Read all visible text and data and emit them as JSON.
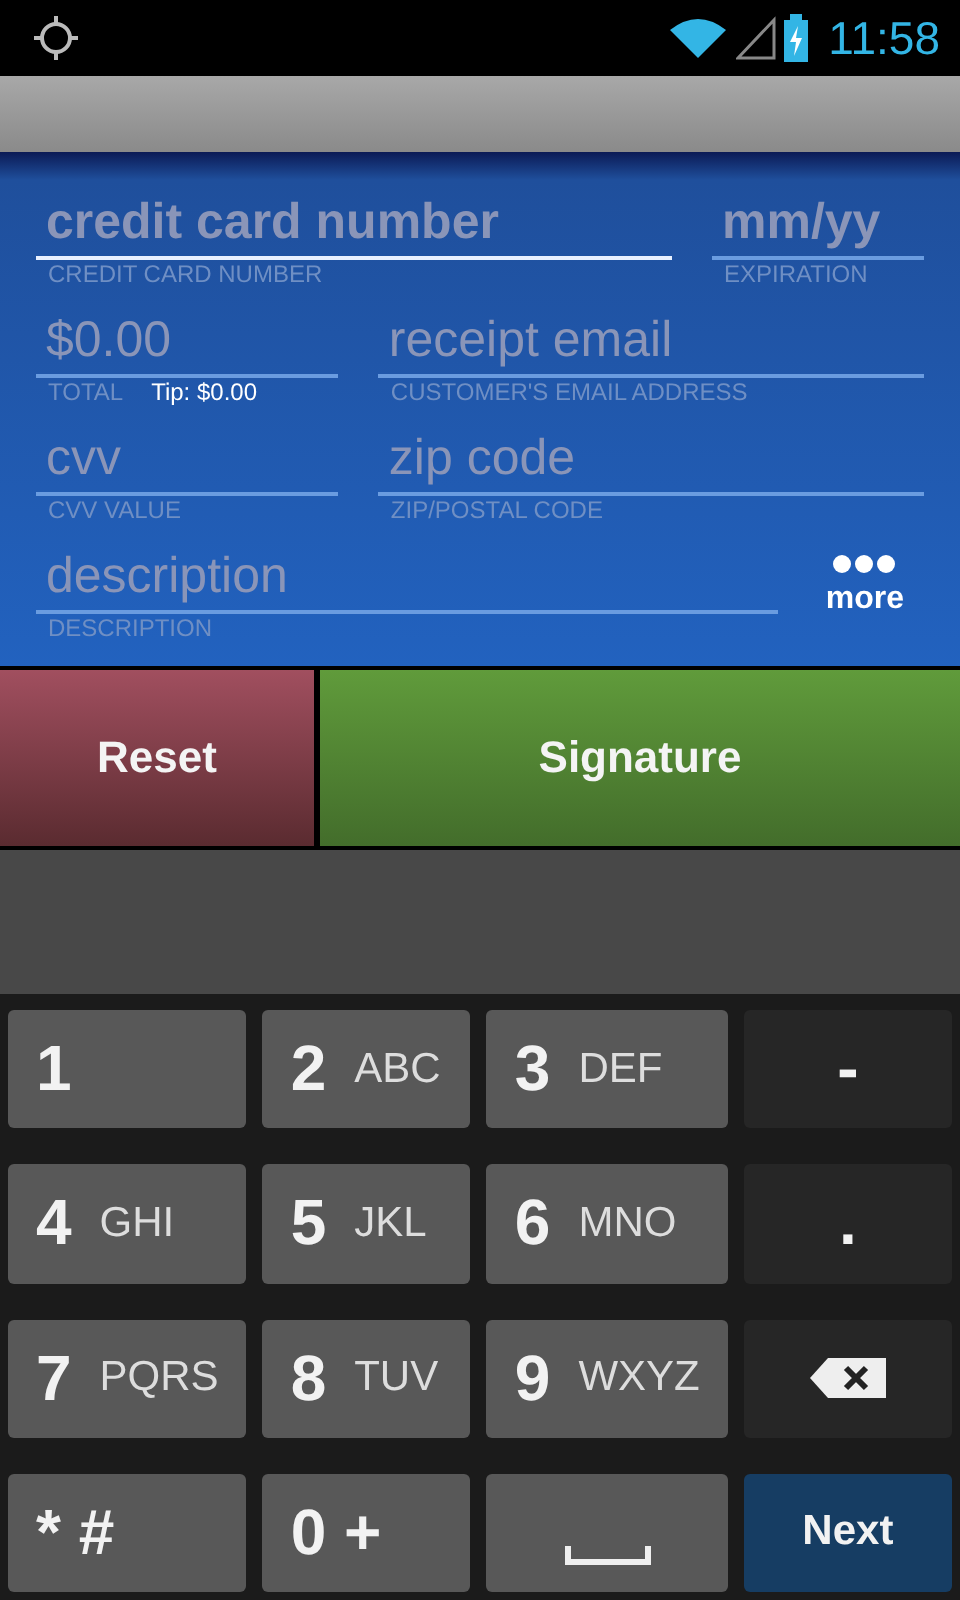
{
  "status_bar": {
    "time": "11:58"
  },
  "form": {
    "rows": [
      [
        {
          "placeholder": "credit card number",
          "caption": "CREDIT CARD NUMBER",
          "focused": true
        },
        {
          "placeholder": "mm/yy",
          "caption": "EXPIRATION",
          "focused": false
        }
      ],
      [
        {
          "placeholder": "$0.00",
          "caption": "TOTAL",
          "tip": "Tip: $0.00",
          "focused": false
        },
        {
          "placeholder": "receipt email",
          "caption": "CUSTOMER'S EMAIL ADDRESS",
          "focused": false
        }
      ],
      [
        {
          "placeholder": "cvv",
          "caption": "CVV VALUE",
          "focused": false
        },
        {
          "placeholder": "zip code",
          "caption": "ZIP/POSTAL CODE",
          "focused": false
        }
      ],
      [
        {
          "placeholder": "description",
          "caption": "DESCRIPTION",
          "focused": false
        }
      ]
    ],
    "more": {
      "label": "more"
    }
  },
  "buttons": [
    {
      "label": "Reset",
      "kind": "reset"
    },
    {
      "label": "Signature",
      "kind": "primary"
    }
  ],
  "keyboard": [
    {
      "kind": "digit",
      "main": "1"
    },
    {
      "kind": "digit",
      "main": "2",
      "letters": "ABC"
    },
    {
      "kind": "digit",
      "main": "3",
      "letters": "DEF"
    },
    {
      "kind": "symbol",
      "main": "-"
    },
    {
      "kind": "digit",
      "main": "4",
      "letters": "GHI"
    },
    {
      "kind": "digit",
      "main": "5",
      "letters": "JKL"
    },
    {
      "kind": "digit",
      "main": "6",
      "letters": "MNO"
    },
    {
      "kind": "symbol",
      "main": "."
    },
    {
      "kind": "digit",
      "main": "7",
      "letters": "PQRS"
    },
    {
      "kind": "digit",
      "main": "8",
      "letters": "TUV"
    },
    {
      "kind": "digit",
      "main": "9",
      "letters": "WXYZ"
    },
    {
      "kind": "backspace"
    },
    {
      "kind": "digit",
      "main": "* #"
    },
    {
      "kind": "digit",
      "main": "0 +"
    },
    {
      "kind": "space"
    },
    {
      "kind": "action",
      "main": "Next"
    }
  ]
}
